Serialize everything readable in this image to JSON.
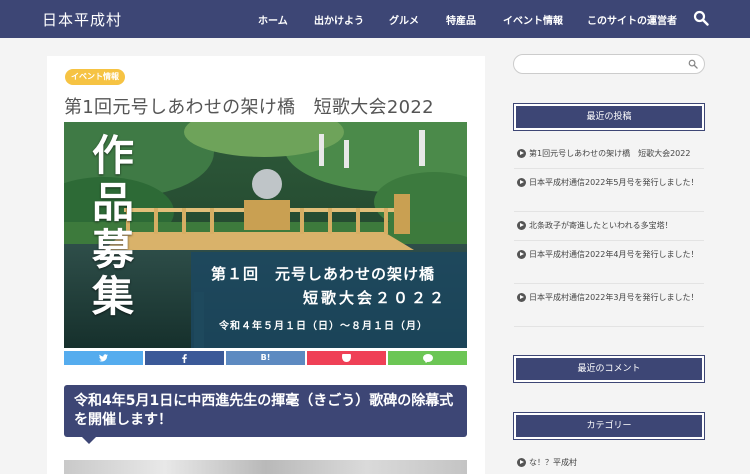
{
  "header": {
    "site_title": "日本平成村",
    "nav": [
      "ホーム",
      "出かけよう",
      "グルメ",
      "特産品",
      "イベント情報",
      "このサイトの運営者"
    ]
  },
  "main": {
    "badge": "イベント情報",
    "title": "第1回元号しあわせの架け橋　短歌大会2022",
    "hero": {
      "big_chars": [
        "作",
        "品",
        "募",
        "集"
      ],
      "line1": "第１回　元号しあわせの架け橋",
      "line2": "短歌大会２０２２",
      "line3": "令和４年５月１日（日）～８月１日（月）"
    },
    "share": [
      {
        "label": "",
        "icon": "twitter-icon",
        "color": "#55acee"
      },
      {
        "label": "",
        "icon": "facebook-icon",
        "color": "#3b5998"
      },
      {
        "label": "B!",
        "icon": "hatena-icon",
        "color": "#5d8ac1"
      },
      {
        "label": "",
        "icon": "pocket-icon",
        "color": "#ef4056"
      },
      {
        "label": "",
        "icon": "line-icon",
        "color": "#6cc655"
      }
    ],
    "h2": "令和4年5月1日に中西進先生の揮毫（きごう）歌碑の除幕式を開催します！"
  },
  "sidebar": {
    "search_placeholder": "",
    "recent_posts_title": "最近の投稿",
    "recent_posts": [
      "第1回元号しあわせの架け橋　短歌大会2022",
      "日本平成村通信2022年5月号を発行しました！",
      "北条政子が寄進したといわれる多宝塔！",
      "日本平成村通信2022年4月号を発行しました！",
      "日本平成村通信2022年3月号を発行しました！"
    ],
    "recent_comments_title": "最近のコメント",
    "categories_title": "カテゴリー",
    "categories": [
      "な！？平成村"
    ]
  },
  "colors": {
    "header": "#3d4675",
    "badge": "#f6c343"
  }
}
